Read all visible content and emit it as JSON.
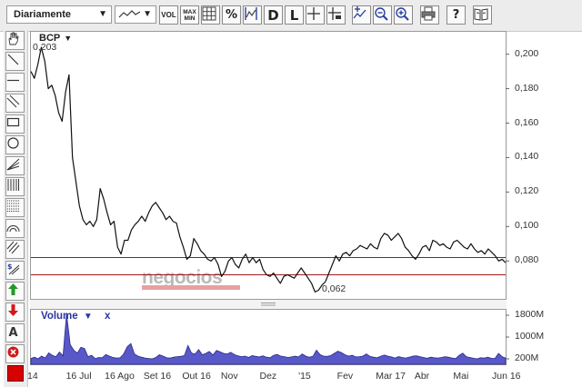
{
  "toolbar": {
    "period": "Diariamente",
    "vol_label": "VOL",
    "maxmin_top": "MAX",
    "maxmin_bottom": "MIN",
    "percent_label": "%",
    "d_label": "D",
    "l_label": "L",
    "help_label": "?"
  },
  "chart": {
    "symbol": "BCP",
    "max_label": "0,203",
    "min_label": "0,062",
    "volume_label": "Volume",
    "volume_caret": "▼",
    "volume_close": "x",
    "watermark": "negocios",
    "y_ticks": [
      "0,200",
      "0,180",
      "0,160",
      "0,140",
      "0,120",
      "0,100",
      "0,080"
    ],
    "vol_ticks": [
      "1800M",
      "1000M",
      "200M"
    ],
    "x_ticks": [
      "14",
      "16 Jul",
      "16 Ago",
      "Set 16",
      "Out 16",
      "Nov",
      "Dez",
      "'15",
      "Fev",
      "Mar 17",
      "Abr",
      "Mai",
      "Jun 16"
    ]
  },
  "chart_data": {
    "type": "line",
    "title": "BCP",
    "ylim": [
      0.058,
      0.213
    ],
    "series": [
      {
        "values": [
          0.19,
          0.186,
          0.194,
          0.204,
          0.196,
          0.18,
          0.182,
          0.176,
          0.166,
          0.161,
          0.178,
          0.188,
          0.14,
          0.126,
          0.112,
          0.104,
          0.101,
          0.103,
          0.1,
          0.104,
          0.122,
          0.116,
          0.108,
          0.101,
          0.103,
          0.088,
          0.084,
          0.092,
          0.092,
          0.098,
          0.101,
          0.103,
          0.106,
          0.103,
          0.108,
          0.112,
          0.114,
          0.111,
          0.108,
          0.104,
          0.106,
          0.103,
          0.102,
          0.094,
          0.088,
          0.081,
          0.083,
          0.093,
          0.09,
          0.086,
          0.084,
          0.081,
          0.08,
          0.082,
          0.078,
          0.071,
          0.074,
          0.08,
          0.082,
          0.078,
          0.076,
          0.081,
          0.084,
          0.079,
          0.082,
          0.079,
          0.081,
          0.075,
          0.072,
          0.071,
          0.073,
          0.07,
          0.067,
          0.071,
          0.072,
          0.071,
          0.07,
          0.073,
          0.076,
          0.073,
          0.07,
          0.067,
          0.062,
          0.063,
          0.066,
          0.068,
          0.073,
          0.078,
          0.083,
          0.08,
          0.084,
          0.085,
          0.083,
          0.086,
          0.087,
          0.089,
          0.088,
          0.087,
          0.09,
          0.088,
          0.087,
          0.093,
          0.096,
          0.095,
          0.092,
          0.094,
          0.096,
          0.093,
          0.088,
          0.086,
          0.083,
          0.081,
          0.084,
          0.088,
          0.089,
          0.086,
          0.092,
          0.091,
          0.089,
          0.09,
          0.088,
          0.087,
          0.091,
          0.092,
          0.09,
          0.088,
          0.087,
          0.09,
          0.087,
          0.085,
          0.086,
          0.084,
          0.087,
          0.085,
          0.083,
          0.08,
          0.081,
          0.079
        ]
      }
    ],
    "horizontal_lines": [
      0.082,
      0.072
    ],
    "volume": {
      "ylim": [
        0,
        2000
      ],
      "values": [
        210,
        260,
        200,
        300,
        230,
        420,
        330,
        280,
        450,
        310,
        1850,
        720,
        520,
        410,
        620,
        580,
        280,
        330,
        210,
        250,
        240,
        360,
        300,
        250,
        230,
        240,
        380,
        650,
        760,
        380,
        300,
        260,
        230,
        210,
        200,
        250,
        350,
        300,
        240,
        230,
        260,
        280,
        290,
        320,
        690,
        410,
        380,
        540,
        350,
        400,
        470,
        340,
        510,
        460,
        400,
        380,
        440,
        360,
        310,
        280,
        300,
        250,
        320,
        290,
        270,
        310,
        260,
        240,
        330,
        360,
        300,
        280,
        250,
        270,
        300,
        270,
        380,
        300,
        260,
        290,
        520,
        360,
        300,
        290,
        320,
        400,
        480,
        430,
        350,
        300,
        330,
        270,
        280,
        300,
        380,
        290,
        260,
        240,
        290,
        340,
        300,
        270,
        230,
        280,
        250,
        230,
        260,
        300,
        310,
        280,
        250,
        220,
        260,
        240,
        230,
        250,
        280,
        260,
        230,
        210,
        330,
        410,
        280,
        250,
        220,
        200,
        240,
        230,
        260,
        220,
        210,
        400,
        280,
        230
      ]
    }
  },
  "colors": {
    "price_line": "#111111",
    "hline": "#a01818",
    "volume_fill": "#5858c8",
    "volume_stroke": "#2a2a8c",
    "color_picker": "#d90000"
  },
  "left_tools": [
    "hand-icon",
    "trend-line-icon",
    "horizontal-line-icon",
    "parallel-channel-icon",
    "rectangle-icon",
    "circle-icon",
    "fan-icon",
    "fibonacci-retracement-icon",
    "fibonacci-levels-icon",
    "arc-icon",
    "channel-lines-icon",
    "dollar-lines-icon",
    "buy-arrow-icon",
    "sell-arrow-icon",
    "text-icon",
    "delete-icon"
  ]
}
